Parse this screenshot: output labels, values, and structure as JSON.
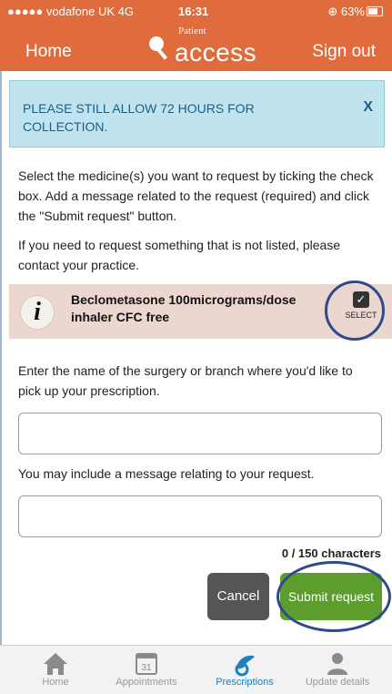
{
  "status": {
    "carrier": "●●●●● vodafone UK  4G",
    "time": "16:31",
    "battery": "⊕ 63%"
  },
  "header": {
    "home_label": "Home",
    "signout_label": "Sign out",
    "logo_small": "Patient",
    "logo_big": "access"
  },
  "alert": {
    "text": "PLEASE STILL ALLOW 72 HOURS FOR COLLECTION.",
    "close": "X"
  },
  "intro": {
    "p1": "Select the medicine(s) you want to request by ticking the check box. Add a message related to the request (required) and click the \"Submit request\" button.",
    "p2": "If you need to request something that is not listed, please contact your practice."
  },
  "medicine": {
    "name": "Beclometasone 100micrograms/dose inhaler CFC free",
    "select_label": "SELECT",
    "checked": true
  },
  "form": {
    "surgery_label": "Enter the name of the surgery or branch where you'd like to pick up your prescription.",
    "surgery_value": "",
    "message_label": "You may include a message relating to your request.",
    "message_value": "",
    "counter": "0 / 150 characters"
  },
  "buttons": {
    "cancel": "Cancel",
    "submit": "Submit request"
  },
  "tabs": [
    {
      "label": "Home",
      "icon": "home-icon",
      "active": false
    },
    {
      "label": "Appointments",
      "icon": "calendar-icon",
      "active": false
    },
    {
      "label": "Prescriptions",
      "icon": "prescriptions-icon",
      "active": true
    },
    {
      "label": "Update details",
      "icon": "person-icon",
      "active": false
    }
  ],
  "colors": {
    "header": "#e06c3e",
    "alert_bg": "#bfe3ef",
    "submit": "#5c9d2e",
    "cancel": "#555555",
    "active_tab": "#1f7fbf"
  }
}
